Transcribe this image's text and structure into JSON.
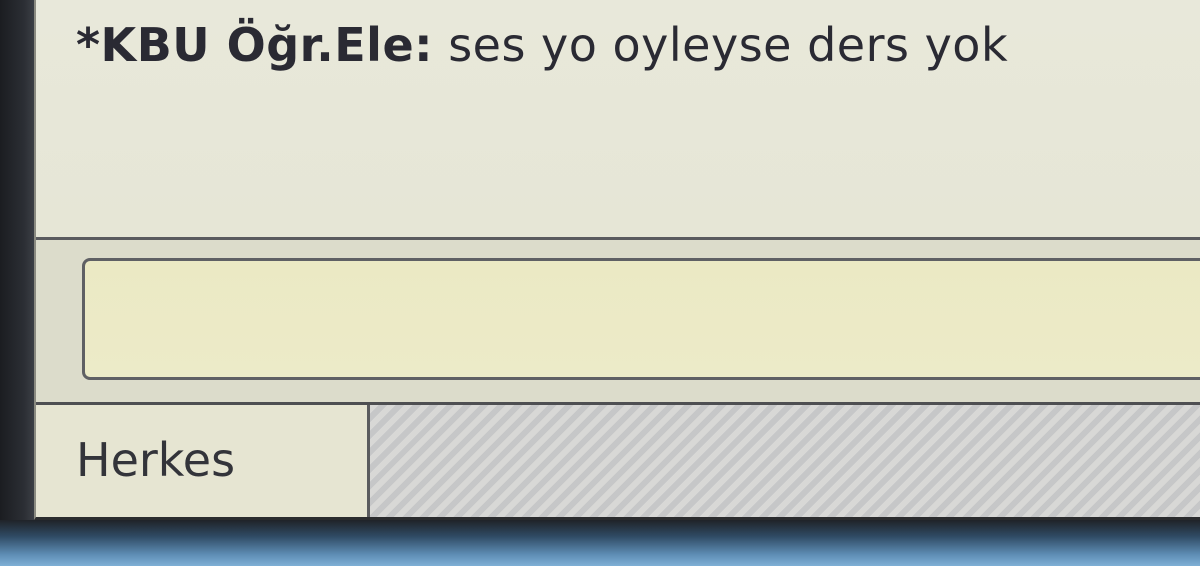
{
  "chat": {
    "message": {
      "sender": "*KBU Öğr.Ele:",
      "text": "ses yo oyleyse ders yok"
    },
    "input": {
      "value": "",
      "placeholder": ""
    },
    "recipient": {
      "label": "Herkes"
    }
  },
  "colors": {
    "window_bg": "#e4e3d4",
    "input_bg": "#ebe9c4",
    "text": "#2a2a33",
    "taskbar": "#5e8db4"
  }
}
